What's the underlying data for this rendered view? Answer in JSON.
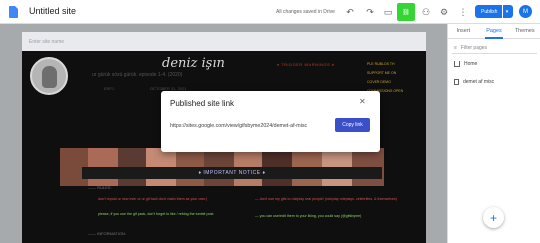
{
  "topbar": {
    "doc_title": "Untitled site",
    "save_status": "All changes saved in Drive",
    "publish_label": "Publish",
    "avatar_letter": "M",
    "icons": [
      "undo-icon",
      "redo-icon",
      "preview-icon",
      "link-icon",
      "add-people-icon",
      "settings-icon",
      "more-icon"
    ]
  },
  "panel": {
    "tabs": [
      {
        "label": "Insert"
      },
      {
        "label": "Pages"
      },
      {
        "label": "Themes"
      }
    ],
    "filter_placeholder": "Filter pages",
    "pages": [
      {
        "label": "Home"
      },
      {
        "label": "demet af misc"
      }
    ]
  },
  "canvas": {
    "header_placeholder": "Enter site name",
    "site": {
      "name": "deniz işın",
      "subtitle": "ur gürük sözü gürük. episode 1-4. (2020)",
      "meta": [
        "ESFJ",
        "OCTOBER 31, 2021"
      ],
      "warning_title": "♦ TRIGGER WARNINGS ♦",
      "right_links": [
        "PLE RUBLOS TH",
        "SUPPORT ME ON",
        "COVER DEMO",
        "COMMISSIONS OPEN"
      ],
      "notice": "♦ IMPORTANT NOTICE ♦",
      "sections": [
        "—— RULES:",
        "—— INFORMATION:"
      ],
      "rules_left": [
        "don't repost ur new ever or ur gif bad! don't claim them as your own:)",
        "please, if you use the gif pack, don't forget to like / reblog the tumblr post.",
        "you are free to use"
      ],
      "rules_right": [
        "— don't use my gifs to roleplay real people! (roleplay roleplays, celebrities, & themselves)",
        "— you can use/edit them to your liking, you could say (@gifsbyme)"
      ]
    }
  },
  "modal": {
    "title": "Published site link",
    "url": "https://sites.google.com/view/gifsbyme2024/demet-af-misc",
    "copy_label": "Copy link"
  },
  "colors": {
    "accent": "#1a73e8",
    "copy_button": "#3b50c8",
    "highlight_button": "#33d633"
  }
}
